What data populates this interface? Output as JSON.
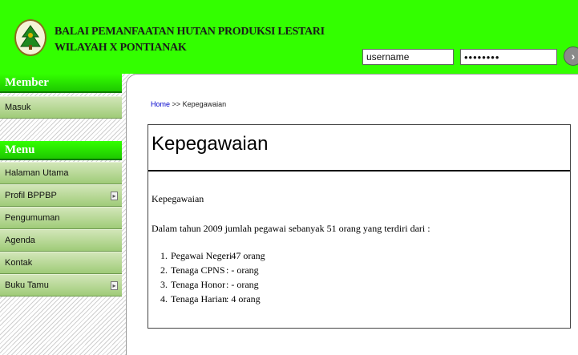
{
  "header": {
    "title_line1": "BALAI PEMANFAATAN HUTAN PRODUKSI LESTARI",
    "title_line2": "WILAYAH X PONTIANAK",
    "username_value": "username",
    "password_value": "••••••••",
    "login_button": "›"
  },
  "sidebar": {
    "member_heading": "Member",
    "member_items": [
      {
        "label": "Masuk"
      }
    ],
    "menu_heading": "Menu",
    "menu_items": [
      {
        "label": "Halaman Utama",
        "has_submenu": false
      },
      {
        "label": "Profil BPPBP",
        "has_submenu": true
      },
      {
        "label": "Pengumuman",
        "has_submenu": false
      },
      {
        "label": "Agenda",
        "has_submenu": false
      },
      {
        "label": "Kontak",
        "has_submenu": false
      },
      {
        "label": "Buku Tamu",
        "has_submenu": true
      }
    ]
  },
  "breadcrumb": {
    "home": "Home",
    "separator": ">>",
    "current": "Kepegawaian"
  },
  "content": {
    "heading": "Kepegawaian",
    "intro": "Kepegawaian",
    "summary": "Dalam tahun 2009 jumlah pegawai sebanyak 51 orang yang terdiri dari :",
    "staff": [
      {
        "num": "1.",
        "name": "Pegawai Negeri",
        "count": ": 47 orang"
      },
      {
        "num": "2.",
        "name": "Tenaga CPNS",
        "count": ": - orang"
      },
      {
        "num": "3.",
        "name": "Tenaga Honor",
        "count": ": - orang"
      },
      {
        "num": "4.",
        "name": "Tenaga Harian",
        "count": ": 4 orang"
      }
    ]
  },
  "colors": {
    "header_bg": "#33ff00",
    "sidebar_heading": "#33ff00",
    "sidebar_item": "#b5d795",
    "link": "#0000cc"
  },
  "icons": {
    "logo": "forest-emblem-icon",
    "submenu_arrow": "chevron-right-icon",
    "login": "arrow-right-circle-icon"
  }
}
